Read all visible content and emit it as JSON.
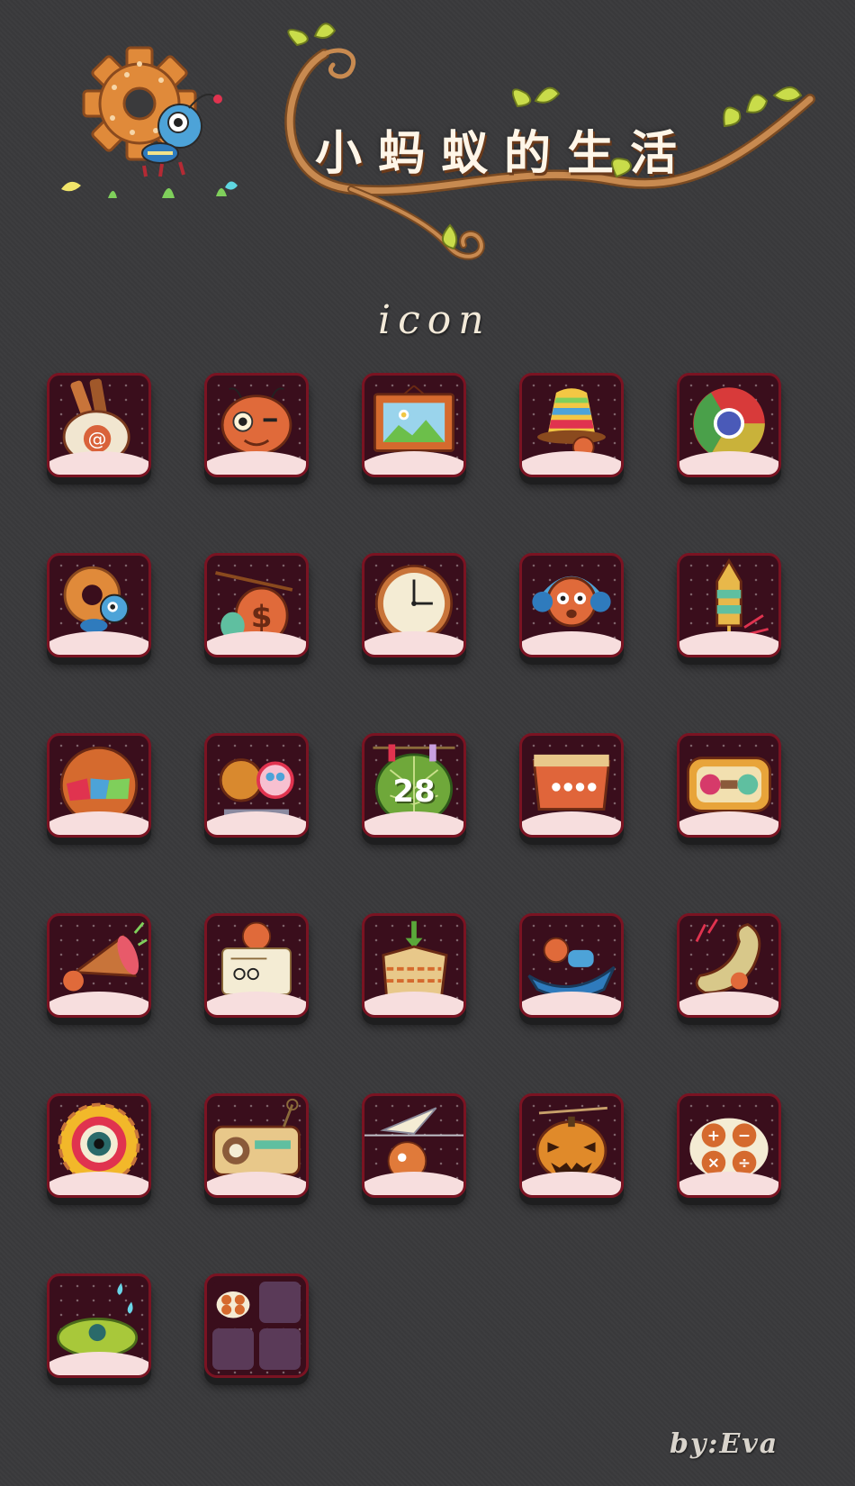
{
  "header": {
    "title": "小蚂蚁的生活",
    "subtitle": "icon"
  },
  "footer": {
    "byline": "by:Eva"
  },
  "colors": {
    "background": "#3a3a3c",
    "tile": "#3a0e1c",
    "tile_border": "#7a1322",
    "ground": "#f7dede",
    "title_text": "#fff6e8",
    "vine": "#b97a44",
    "leaf": "#c9dc4a"
  },
  "icons": [
    {
      "name": "mail-scroll-icon"
    },
    {
      "name": "ant-face-icon"
    },
    {
      "name": "picture-frame-icon"
    },
    {
      "name": "striped-hat-icon"
    },
    {
      "name": "browser-ball-icon"
    },
    {
      "name": "gear-ant-icon"
    },
    {
      "name": "money-bag-icon"
    },
    {
      "name": "clock-icon"
    },
    {
      "name": "headphones-ant-icon"
    },
    {
      "name": "rocket-icon"
    },
    {
      "name": "jigsaw-ball-icon"
    },
    {
      "name": "ant-magnifier-icon"
    },
    {
      "name": "calendar-leaf-icon",
      "label": "28"
    },
    {
      "name": "pouch-icon"
    },
    {
      "name": "game-console-icon"
    },
    {
      "name": "megaphone-icon"
    },
    {
      "name": "ant-paper-icon"
    },
    {
      "name": "package-icon"
    },
    {
      "name": "ant-boat-icon"
    },
    {
      "name": "phone-receiver-icon"
    },
    {
      "name": "sunflower-eye-icon"
    },
    {
      "name": "radio-icon"
    },
    {
      "name": "paper-plane-icon"
    },
    {
      "name": "pumpkin-icon"
    },
    {
      "name": "calculator-ant-icon"
    },
    {
      "name": "lotus-leaf-icon"
    },
    {
      "name": "folder-icon"
    }
  ]
}
